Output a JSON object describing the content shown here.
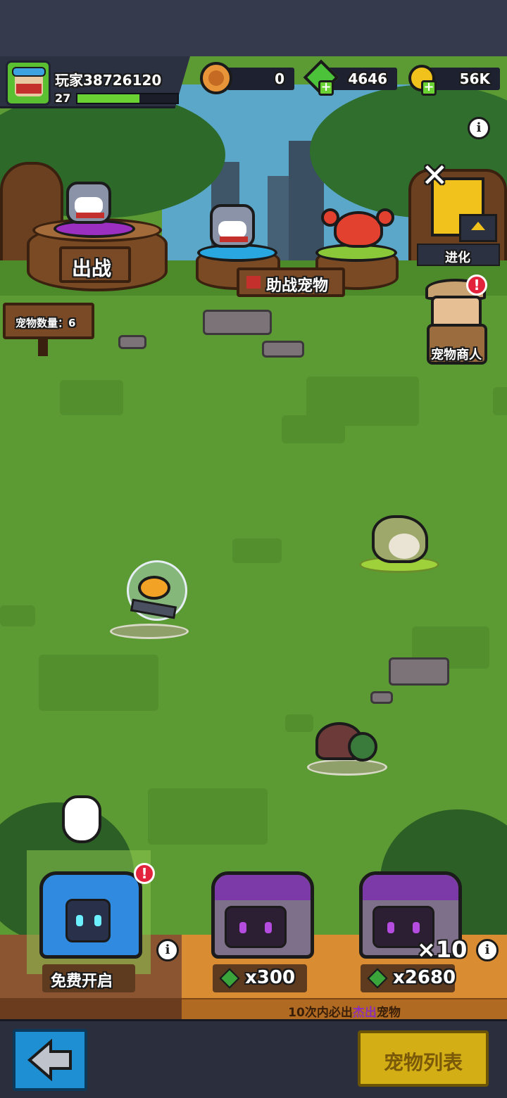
{
  "player": {
    "name": "玩家38726120",
    "level": "27",
    "xp_fraction": 0.62
  },
  "resources": [
    {
      "icon": "pet-coin-icon",
      "value": "0"
    },
    {
      "icon": "green-gem-plus-icon",
      "value": "4646"
    },
    {
      "icon": "gold-coin-plus-icon",
      "value": "56K"
    }
  ],
  "scene": {
    "battle_label": "出战",
    "assist_label": "助战宠物",
    "pet_count_label": "宠物数量：6",
    "evolve_label": "进化",
    "merchant_label": "宠物商人",
    "close_symbol": "✕",
    "info_symbol": "i"
  },
  "chests": [
    {
      "label": "免费开启"
    },
    {
      "price": "x300"
    },
    {
      "price": "x2680",
      "multiplier": "×10"
    }
  ],
  "guarantee_text_before": "10次内必出",
  "guarantee_text_highlight": "杰出",
  "guarantee_text_after": "宠物",
  "buttons": {
    "pet_list": "宠物列表"
  },
  "colors": {
    "accent_green": "#6bd233",
    "badge_red": "#e3233c",
    "button_yellow": "#d4ae15",
    "back_blue": "#1e8fd2"
  }
}
